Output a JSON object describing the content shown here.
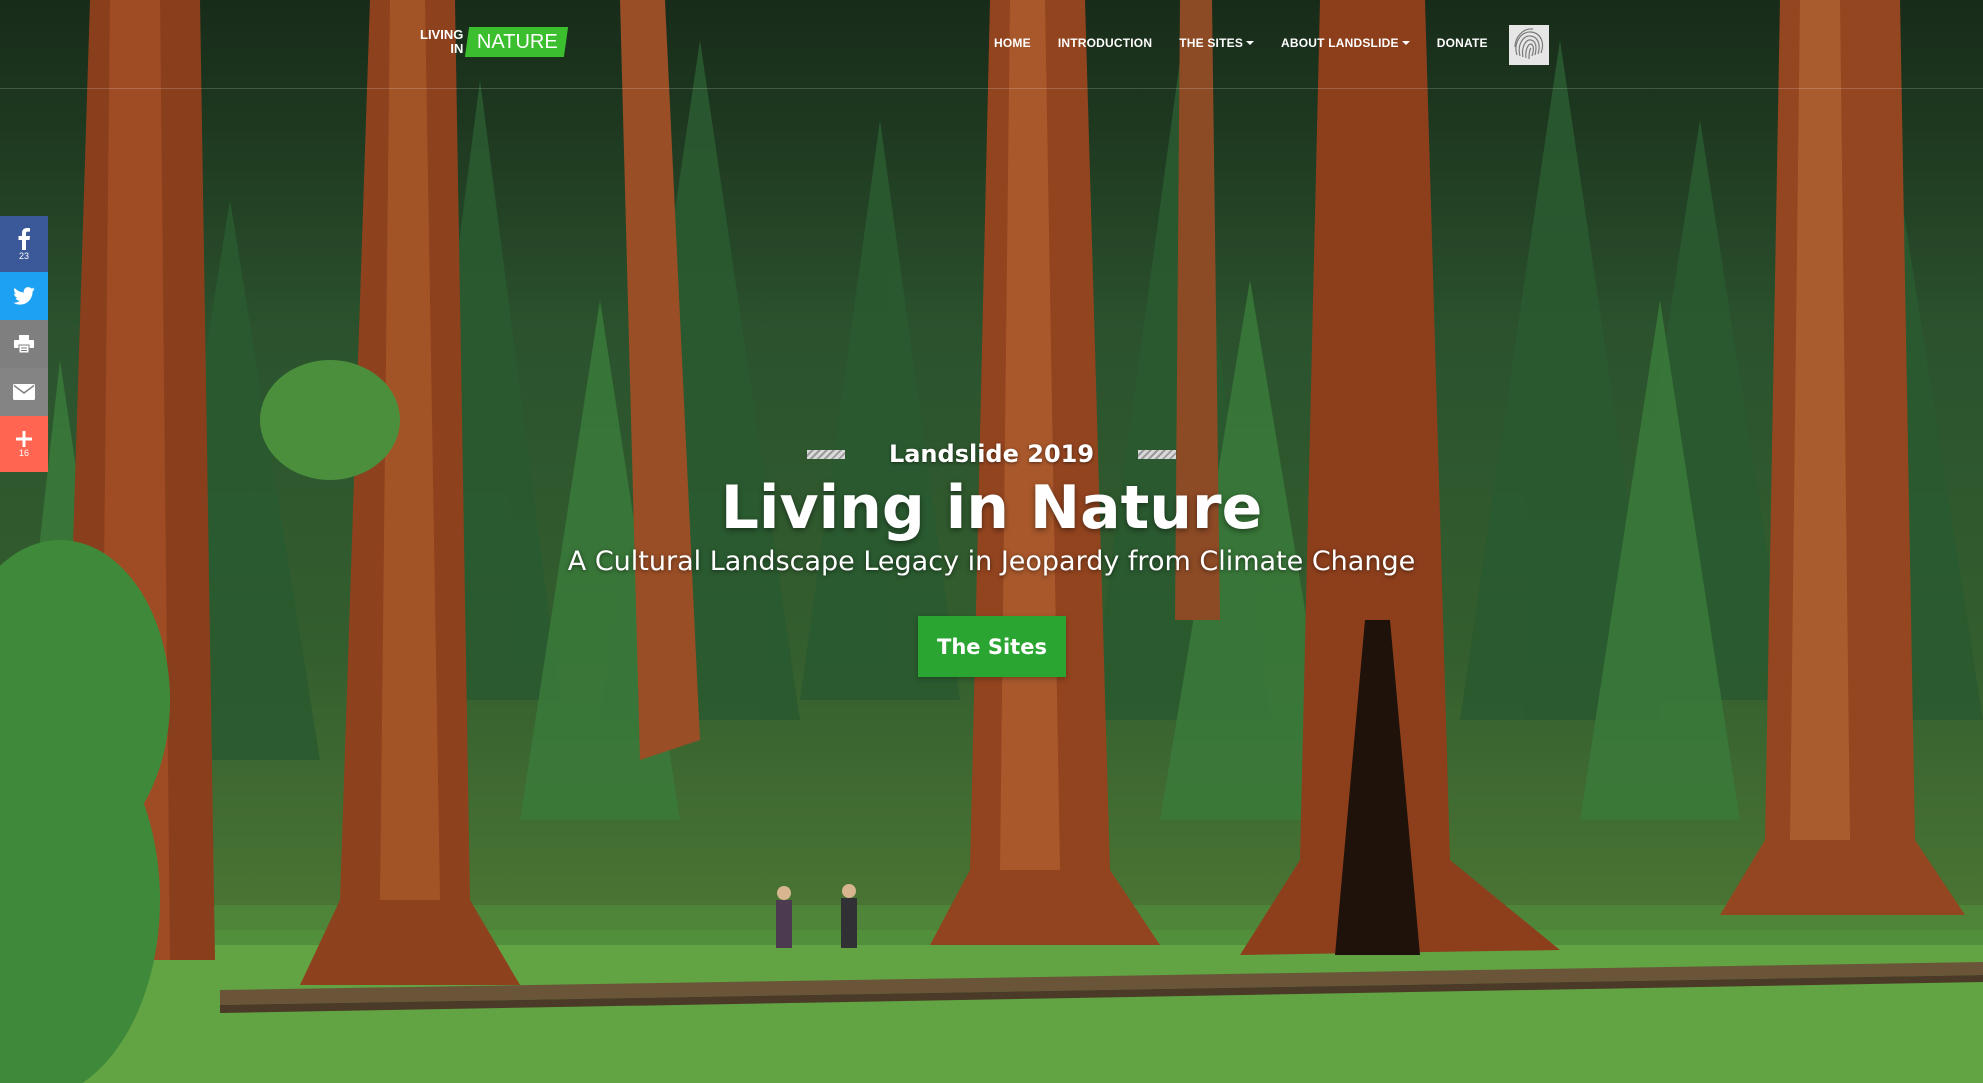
{
  "nav": {
    "logo": {
      "line1": "LIVING",
      "line2": "IN",
      "box": "NATURE"
    },
    "items": [
      {
        "label": "HOME",
        "dropdown": false
      },
      {
        "label": "INTRODUCTION",
        "dropdown": false
      },
      {
        "label": "THE SITES",
        "dropdown": true
      },
      {
        "label": "ABOUT LANDSLIDE",
        "dropdown": true
      },
      {
        "label": "DONATE",
        "dropdown": false
      }
    ],
    "fingerprint_icon": "fingerprint-logo-icon"
  },
  "share": {
    "facebook": {
      "icon": "facebook-icon",
      "count": "23",
      "color": "#3b5998"
    },
    "twitter": {
      "icon": "twitter-icon",
      "color": "#1da1f2"
    },
    "print": {
      "icon": "print-icon",
      "color": "#7f7f7f"
    },
    "email": {
      "icon": "email-icon",
      "color": "#848484"
    },
    "more": {
      "icon": "plus-icon",
      "count": "16",
      "color": "#ff6550"
    }
  },
  "hero": {
    "eyebrow": "Landslide 2019",
    "title": "Living in Nature",
    "subtitle": "A Cultural Landscape Legacy in Jeopardy from Climate Change",
    "cta_label": "The Sites",
    "accent_color": "#2ba532"
  }
}
